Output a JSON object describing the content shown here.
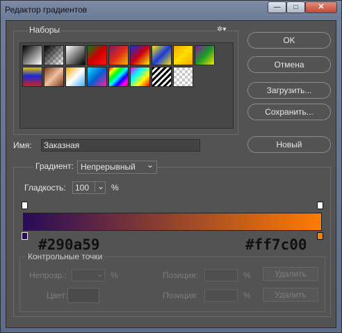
{
  "window": {
    "title": "Редактор градиентов",
    "min_glyph": "—",
    "max_glyph": "□",
    "close_glyph": "✕"
  },
  "presets": {
    "label": "Наборы",
    "gear_glyph": "✲▾"
  },
  "buttons": {
    "ok": "OK",
    "cancel": "Отмена",
    "load": "Загрузить...",
    "save": "Сохранить...",
    "new": "Новый"
  },
  "name": {
    "label": "Имя:",
    "value": "Заказная"
  },
  "gradient": {
    "type_label": "Градиент:",
    "type_value": "Непрерывный",
    "smooth_label": "Гладкость:",
    "smooth_value": "100",
    "smooth_unit": "%",
    "color_start": "#290a59",
    "color_end": "#ff7c00"
  },
  "annotations": {
    "left_hex": "#290a59",
    "right_hex": "#ff7c00"
  },
  "stops": {
    "legend": "Контрольные точки",
    "opacity_label": "Непрозр.:",
    "opacity_unit": "%",
    "pos_label_1": "Позиция:",
    "pos_unit_1": "%",
    "delete_1": "Удалить",
    "color_label": "Цвет:",
    "pos_label_2": "Позиция:",
    "pos_unit_2": "%",
    "delete_2": "Удалить"
  },
  "icons": {
    "chevron": "⌄"
  }
}
